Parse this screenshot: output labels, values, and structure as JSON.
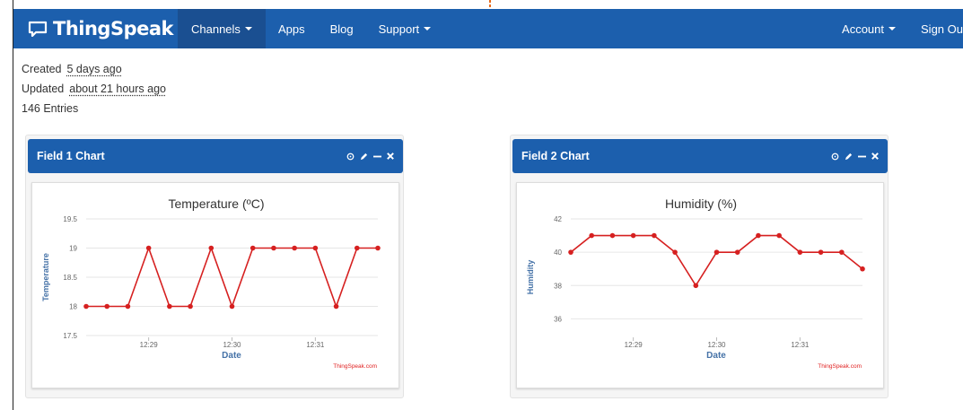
{
  "navbar": {
    "brand": "ThingSpeak",
    "items": [
      {
        "label": "Channels",
        "dropdown": true,
        "active": true
      },
      {
        "label": "Apps",
        "dropdown": false
      },
      {
        "label": "Blog",
        "dropdown": false
      },
      {
        "label": "Support",
        "dropdown": true
      }
    ],
    "right_items": [
      {
        "label": "Account",
        "dropdown": true
      },
      {
        "label": "Sign Ou",
        "dropdown": false
      }
    ],
    "bg_color": "#1c5fad"
  },
  "channel_meta": {
    "created_label": "Created",
    "created_value": "5 days ago",
    "updated_label": "Updated",
    "updated_value": "about 21 hours ago",
    "entries": "146 Entries"
  },
  "panels": [
    {
      "title": "Field 1 Chart",
      "icons": [
        "comment-icon",
        "edit-icon",
        "minimize-icon",
        "close-icon"
      ]
    },
    {
      "title": "Field 2 Chart",
      "icons": [
        "comment-icon",
        "edit-icon",
        "minimize-icon",
        "close-icon"
      ]
    }
  ],
  "chart_data": [
    {
      "type": "line",
      "title": "Temperature (ºC)",
      "xlabel": "Date",
      "ylabel": "Temperature",
      "y_ticks": [
        "19.5",
        "19",
        "18.5",
        "18",
        "17.5"
      ],
      "ylim": [
        17.5,
        19.5
      ],
      "x_ticks": [
        "12:29",
        "12:30",
        "12:31"
      ],
      "x_tick_positions": [
        3,
        7,
        11
      ],
      "x": [
        0,
        1,
        2,
        3,
        4,
        5,
        6,
        7,
        8,
        9,
        10,
        11,
        12,
        13,
        14
      ],
      "values": [
        18,
        18,
        18,
        19,
        18,
        18,
        19,
        18,
        19,
        19,
        19,
        19,
        18,
        19,
        19
      ],
      "series_color": "#d62020",
      "credit": "ThingSpeak.com",
      "grid": true
    },
    {
      "type": "line",
      "title": "Humidity (%)",
      "xlabel": "Date",
      "ylabel": "Humidity",
      "y_ticks": [
        "42",
        "40",
        "38",
        "36"
      ],
      "ylim": [
        35,
        42
      ],
      "x_ticks": [
        "12:29",
        "12:30",
        "12:31"
      ],
      "x_tick_positions": [
        3,
        7,
        11
      ],
      "x": [
        0,
        1,
        2,
        3,
        4,
        5,
        6,
        7,
        8,
        9,
        10,
        11,
        12,
        13,
        14
      ],
      "values": [
        40,
        41,
        41,
        41,
        41,
        40,
        38,
        40,
        40,
        41,
        41,
        40,
        40,
        40,
        39
      ],
      "series_color": "#d62020",
      "credit": "ThingSpeak.com",
      "grid": true
    }
  ]
}
